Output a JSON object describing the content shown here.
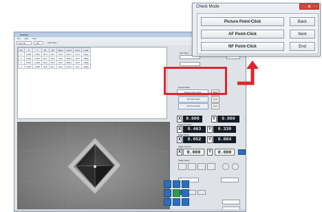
{
  "main_window": {
    "title": "Indent...",
    "menu": [
      "File",
      "Edit",
      "View"
    ],
    "toolbar": {
      "item1": "Line No",
      "item2": "1/8",
      "checkbox_label": "Auto Mea..."
    }
  },
  "table": {
    "headers": [
      "No",
      "X",
      "Y",
      "D1",
      "D2",
      "Dave",
      "Hard",
      "Conv",
      "Load"
    ],
    "rows": [
      [
        "1",
        "0.000",
        "0.000",
        "29.3",
        "29.3",
        "29.3",
        "215.7",
        "21.5",
        "100gf"
      ],
      [
        "2",
        "0.000",
        "0.000",
        "30.1",
        "30.0",
        "30.0",
        "205.3",
        "20.5",
        "100gf"
      ],
      [
        "3",
        "0.000",
        "0.000",
        "29.8",
        "29.9",
        "29.9",
        "208.1",
        "20.8",
        "100gf"
      ],
      [
        "4",
        "0.000",
        "0.000",
        "29.6",
        "29.7",
        "29.6",
        "211.2",
        "21.1",
        "100gf"
      ]
    ]
  },
  "right_panel": {
    "top_label": "Test Type",
    "mini_check_title": "Check Mode",
    "mini_buttons": [
      "Picture Point-Click",
      "AF Point-Click",
      "NF Point-Click"
    ],
    "mini_side": [
      "Back",
      "Next",
      "End"
    ],
    "coords": [
      {
        "axis": "X",
        "value": "0.000"
      },
      {
        "axis": "Y",
        "value": "0.000"
      }
    ],
    "coords2": [
      {
        "axis": "X",
        "value": "0.463"
      },
      {
        "axis": "Y",
        "value": "0.330"
      }
    ],
    "coords3": [
      {
        "axis": "X",
        "value": "0.052"
      },
      {
        "axis": "Y",
        "value": "0.004"
      }
    ],
    "coords4": [
      {
        "axis": "X",
        "value": "0.000"
      },
      {
        "axis": "Y",
        "value": "0.000"
      }
    ],
    "labels": [
      "Stage Position",
      "Image Position",
      "Stage Move",
      "Stage Control",
      "Stage Reset"
    ]
  },
  "check_mode_dialog": {
    "title": "Check Mode",
    "close_label": "x",
    "buttons": {
      "picture": "Picture Point-Click",
      "af": "AF Point-Click",
      "nf": "NF Point-Click",
      "back": "Back",
      "next": "Next",
      "end": "End"
    }
  },
  "colors": {
    "highlight": "#e0242b",
    "value_bg": "#151b22",
    "nav": "#2a6fbf"
  }
}
